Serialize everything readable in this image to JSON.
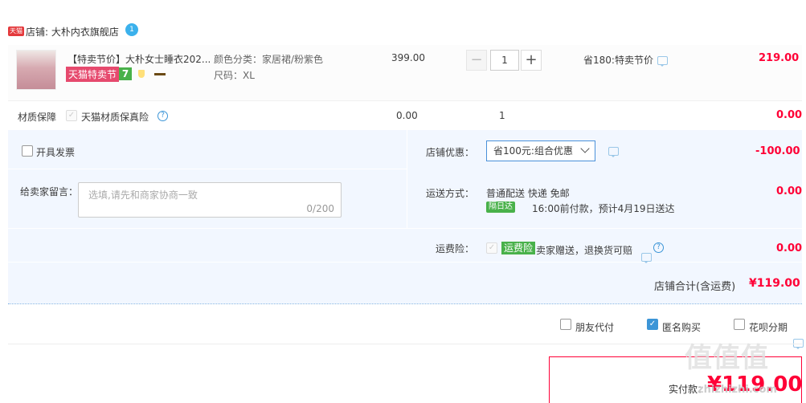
{
  "shop": {
    "badge": "天猫",
    "label": "店铺: 大朴内衣旗舰店",
    "chat_badge": "1"
  },
  "item": {
    "title": "【特卖节价】大朴女士睡衣202...",
    "tags": {
      "tmall_sale": "天猫特卖节",
      "seven_days": "7"
    },
    "sku_color": "颜色分类：家居裙/粉紫色",
    "sku_size": "尺码：XL",
    "unit_price": "399.00",
    "quantity": "1",
    "qty_minus": "−",
    "qty_plus": "+",
    "promo": "省180:特卖节价",
    "subtotal": "219.00"
  },
  "insurance": {
    "section_label": "材质保障",
    "option_label": "天猫材质保真险",
    "help": "?",
    "price": "0.00",
    "qty": "1",
    "total": "0.00"
  },
  "invoice": {
    "label": "开具发票"
  },
  "shop_discount": {
    "label": "店铺优惠：",
    "selected": "省100元:组合优惠",
    "amount": "-100.00"
  },
  "message": {
    "label": "给卖家留言：",
    "placeholder": "选填,请先和商家协商一致",
    "counter": "0/200"
  },
  "shipping": {
    "label": "运送方式：",
    "method": "普通配送 快递 免邮",
    "badge": "隔日达",
    "eta": "16:00前付款，预计4月19日送达",
    "cost": "0.00"
  },
  "freight_insurance": {
    "label": "运费险：",
    "badge": "运费险",
    "desc": "卖家赠送，退换货可赔",
    "help": "?",
    "cost": "0.00"
  },
  "shop_total": {
    "label": "店铺合计(含运费)",
    "amount": "¥119.00"
  },
  "options": {
    "friend_pay": "朋友代付",
    "anonymous": "匿名购买",
    "huabei": "花呗分期"
  },
  "payment": {
    "label": "实付款：",
    "amount": "¥119.00"
  },
  "watermark": {
    "logo": "值值值",
    "url": "zhizhizhi.com"
  },
  "colors": {
    "price_red": "#ff0036",
    "accent_blue": "#3c95d7",
    "panel_blue": "#f2f7ff",
    "tmall_red": "#e64a6e",
    "green": "#49b14a"
  }
}
